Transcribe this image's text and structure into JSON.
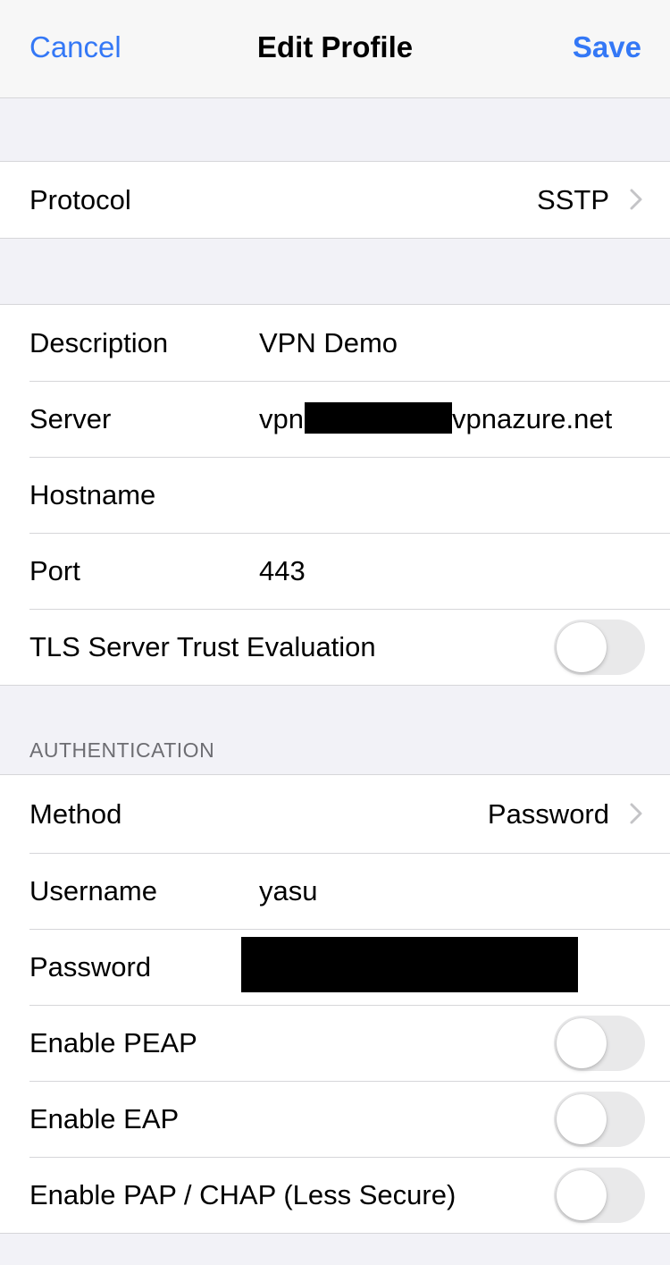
{
  "navbar": {
    "cancel_label": "Cancel",
    "title": "Edit Profile",
    "save_label": "Save"
  },
  "protocol": {
    "label": "Protocol",
    "value": "SSTP"
  },
  "settings": {
    "description": {
      "label": "Description",
      "value": "VPN Demo"
    },
    "server": {
      "label": "Server",
      "value_prefix": "vpn",
      "value_suffix": "vpnazure.net"
    },
    "hostname": {
      "label": "Hostname",
      "value": ""
    },
    "port": {
      "label": "Port",
      "value": "443"
    },
    "tls": {
      "label": "TLS Server Trust Evaluation",
      "enabled": false
    }
  },
  "authentication": {
    "header": "AUTHENTICATION",
    "method": {
      "label": "Method",
      "value": "Password"
    },
    "username": {
      "label": "Username",
      "value": "yasu"
    },
    "password": {
      "label": "Password"
    },
    "peap": {
      "label": "Enable PEAP",
      "enabled": false
    },
    "eap": {
      "label": "Enable EAP",
      "enabled": false
    },
    "pap_chap": {
      "label": "Enable PAP / CHAP (Less Secure)",
      "enabled": false
    }
  },
  "colors": {
    "accent": "#3478f6",
    "toggle_off": "#e9e9ea",
    "background": "#f2f2f7"
  },
  "icons": {
    "chevron": "chevron-right-icon"
  }
}
